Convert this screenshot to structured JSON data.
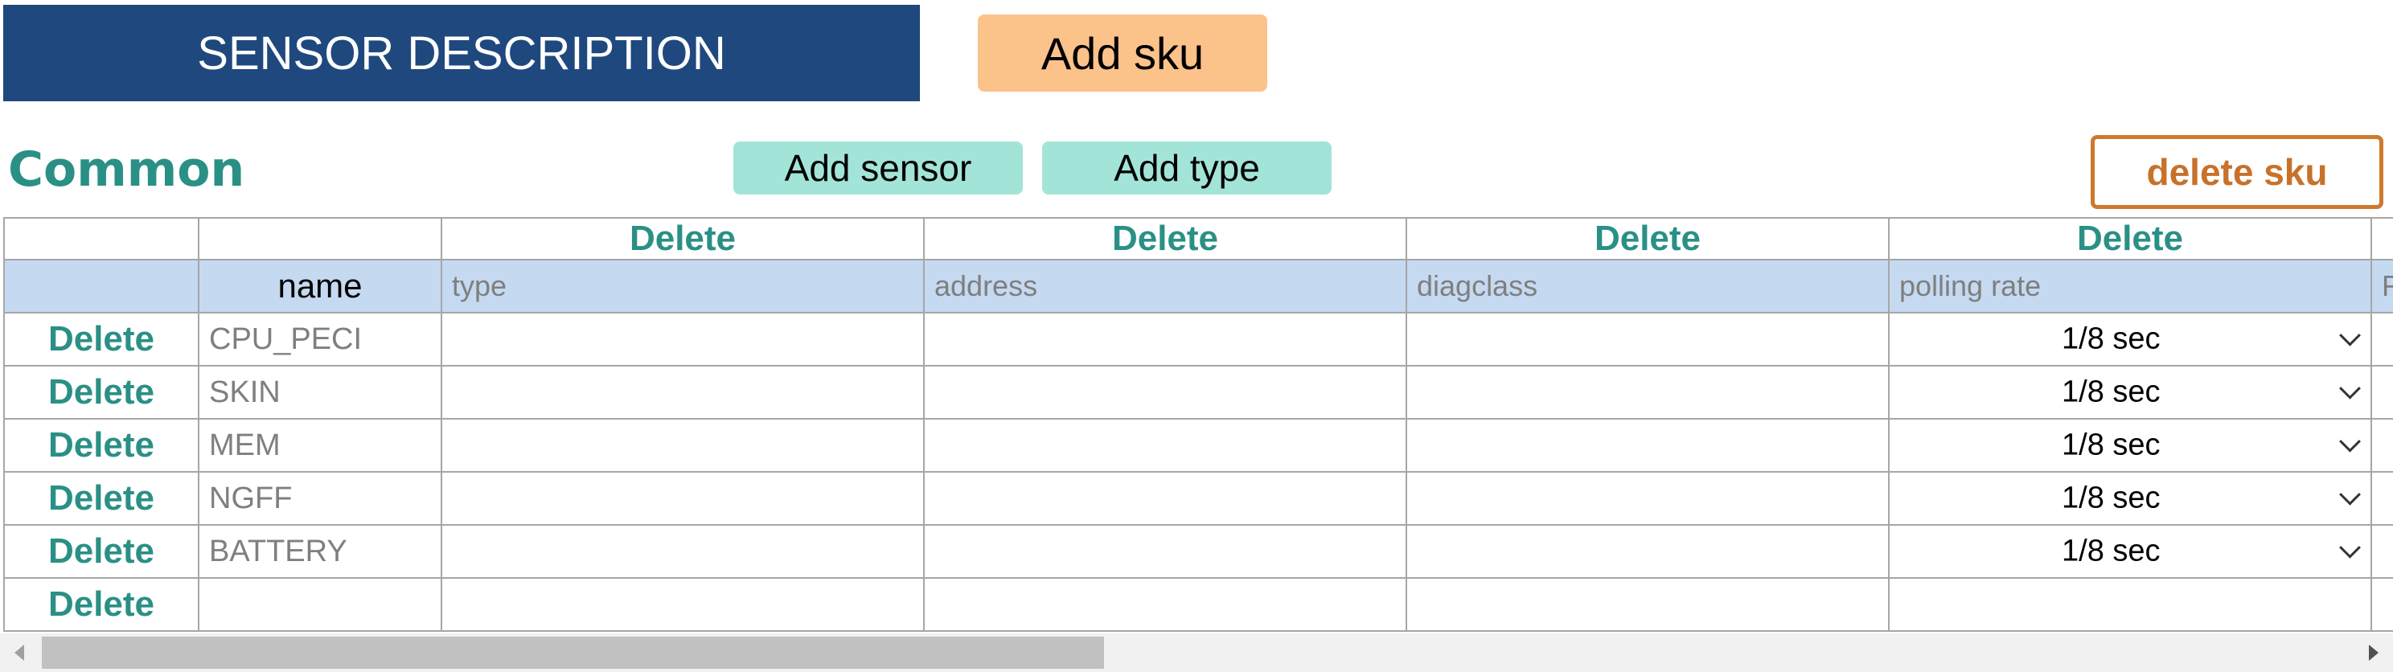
{
  "header": {
    "banner_title": "SENSOR DESCRIPTION",
    "add_sku_label": "Add sku",
    "colors": {
      "banner_bg": "#1f487e",
      "add_sku_bg": "#fbc28a"
    }
  },
  "section": {
    "title": "Common",
    "add_sensor_label": "Add sensor",
    "add_type_label": "Add type",
    "delete_sku_label": "delete sku",
    "colors": {
      "teal": "#2a9085",
      "teal_button_bg": "#a3e4d8",
      "delete_sku_border": "#cc7a2e"
    }
  },
  "table": {
    "column_delete_label": "Delete",
    "headers": {
      "name": "name",
      "type": "type",
      "address": "address",
      "diagclass": "diagclass",
      "polling_rate": "polling rate",
      "next_partial": "F"
    },
    "header_bg": "#c5d9f1",
    "rows": [
      {
        "delete": "Delete",
        "name": "CPU_PECI",
        "type": "",
        "address": "",
        "diagclass": "",
        "polling_rate": "1/8 sec"
      },
      {
        "delete": "Delete",
        "name": "SKIN",
        "type": "",
        "address": "",
        "diagclass": "",
        "polling_rate": "1/8 sec"
      },
      {
        "delete": "Delete",
        "name": "MEM",
        "type": "",
        "address": "",
        "diagclass": "",
        "polling_rate": "1/8 sec"
      },
      {
        "delete": "Delete",
        "name": "NGFF",
        "type": "",
        "address": "",
        "diagclass": "",
        "polling_rate": "1/8 sec"
      },
      {
        "delete": "Delete",
        "name": "BATTERY",
        "type": "",
        "address": "",
        "diagclass": "",
        "polling_rate": "1/8 sec"
      },
      {
        "delete": "Delete",
        "name": "",
        "type": "",
        "address": "",
        "diagclass": "",
        "polling_rate": ""
      }
    ]
  },
  "scrollbar": {
    "thumb_fraction": 0.46,
    "icons": [
      "chevron-left-icon",
      "chevron-right-icon"
    ]
  }
}
